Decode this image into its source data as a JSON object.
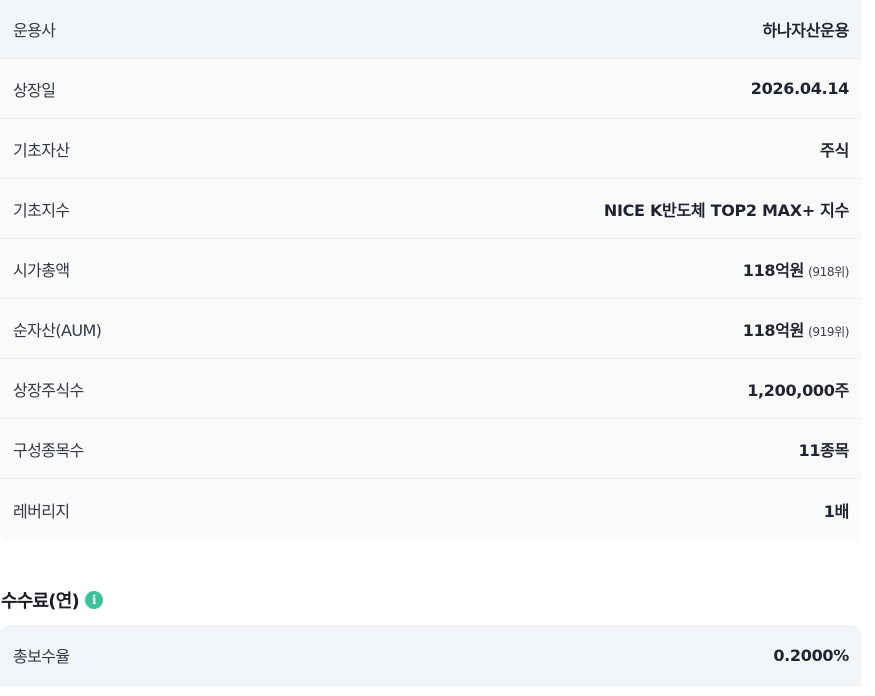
{
  "info": {
    "rows": [
      {
        "label": "운용사",
        "value": "하나자산운용",
        "sub": ""
      },
      {
        "label": "상장일",
        "value": "2026.04.14",
        "sub": ""
      },
      {
        "label": "기초자산",
        "value": "주식",
        "sub": ""
      },
      {
        "label": "기초지수",
        "value": "NICE K반도체 TOP2 MAX+ 지수",
        "sub": ""
      },
      {
        "label": "시가총액",
        "value": "118억원",
        "sub": "(918위)"
      },
      {
        "label": "순자산(AUM)",
        "value": "118억원",
        "sub": "(919위)"
      },
      {
        "label": "상장주식수",
        "value": "1,200,000주",
        "sub": ""
      },
      {
        "label": "구성종목수",
        "value": "11종목",
        "sub": ""
      },
      {
        "label": "레버리지",
        "value": "1배",
        "sub": ""
      }
    ]
  },
  "fees": {
    "title": "수수료(연)",
    "icon": "info-icon",
    "icon_color": "#3cc29a",
    "rows": [
      {
        "label": "총보수율",
        "value": "0.2000%"
      }
    ]
  }
}
